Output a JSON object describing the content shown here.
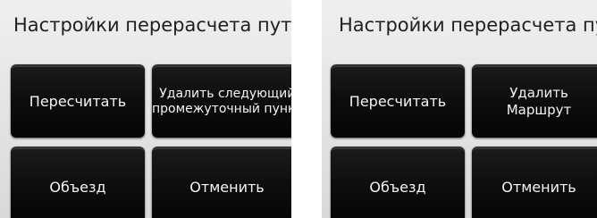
{
  "left_panel": {
    "title": "Настройки перерасчета пути",
    "buttons": {
      "recalculate": "Пересчитать",
      "delete_waypoint_line1": "Удалить следующий",
      "delete_waypoint_line2": "промежуточный пункт",
      "detour": "Объезд",
      "cancel": "Отменить"
    }
  },
  "right_panel": {
    "title": "Настройки перерасчета пути",
    "buttons": {
      "recalculate": "Пересчитать",
      "delete_route_line1": "Удалить",
      "delete_route_line2": "Маршрут",
      "detour": "Объезд",
      "cancel": "Отменить"
    }
  }
}
